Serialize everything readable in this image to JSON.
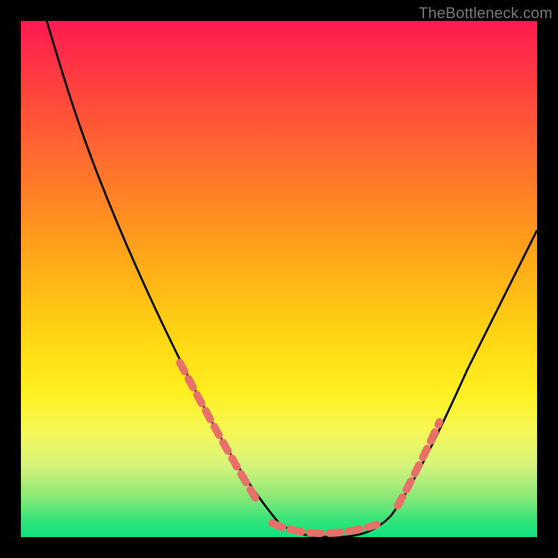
{
  "watermark": "TheBottleneck.com",
  "colors": {
    "background": "#000000",
    "curve": "#000000",
    "marker": "#e77168",
    "gradient_stops": [
      "#ff1a52",
      "#ff3f3f",
      "#ff6a2f",
      "#ff8f20",
      "#ffb416",
      "#ffd814",
      "#fff020",
      "#f4f75a",
      "#d6f37a",
      "#8de876",
      "#2fe47a",
      "#0fe27e"
    ]
  },
  "chart_data": {
    "type": "line",
    "title": "",
    "xlabel": "",
    "ylabel": "",
    "xlim": [
      0,
      100
    ],
    "ylim": [
      0,
      100
    ],
    "x": [
      0,
      5,
      10,
      15,
      20,
      25,
      28,
      30,
      33,
      36,
      40,
      44,
      48,
      52,
      56,
      60,
      64,
      68,
      72,
      75,
      78,
      82,
      86,
      90,
      95,
      100
    ],
    "y": [
      100,
      95,
      89,
      82,
      74,
      64,
      57,
      52,
      44,
      36,
      26,
      16,
      7,
      2,
      0,
      0,
      0,
      2,
      7,
      12,
      18,
      26,
      34,
      41,
      49,
      55
    ],
    "annotations": {
      "marker_style": "dotted-pink-segments",
      "marker_regions_x": [
        [
          28,
          44
        ],
        [
          48,
          68
        ],
        [
          72,
          78
        ]
      ]
    }
  }
}
